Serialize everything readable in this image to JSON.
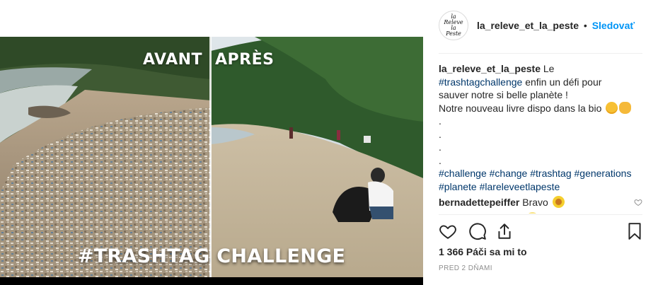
{
  "post": {
    "image": {
      "label_before": "AVANT",
      "label_after": "APRÈS",
      "title": "#TRASHTAG CHALLENGE"
    },
    "header": {
      "avatar_text": "la Releve la Peste",
      "username": "la_releve_et_la_peste",
      "separator": "•",
      "follow_label": "Sledovať"
    },
    "caption": {
      "username": "la_releve_et_la_peste",
      "line1_after_user": " Le",
      "hashtag_main": "#trashtagchallenge",
      "line2_rest": " enfin un défi pour",
      "line3": "sauver notre si belle planète !",
      "line4": "Notre nouveau livre dispo dans la bio",
      "dots": [
        ".",
        ".",
        ".",
        "."
      ],
      "hashtags_line1": [
        "#challenge",
        "#change",
        "#trashtag",
        "#generations"
      ],
      "hashtags_line2": [
        "#planete",
        "#lareleveetlapeste"
      ]
    },
    "comments": [
      {
        "username": "bernadettepeiffer",
        "text": "Bravo"
      }
    ],
    "likes_text": "1 366 Páči sa mi to",
    "timestamp": "PRED 2 DŇAMI",
    "icons": {
      "like": "heart-icon",
      "comment": "comment-icon",
      "share": "share-icon",
      "save": "bookmark-icon",
      "comment_like": "heart-icon"
    },
    "colors": {
      "follow": "#0095f6",
      "hashtag": "#00376b",
      "muted": "#8e8e8e",
      "text": "#262626"
    }
  }
}
